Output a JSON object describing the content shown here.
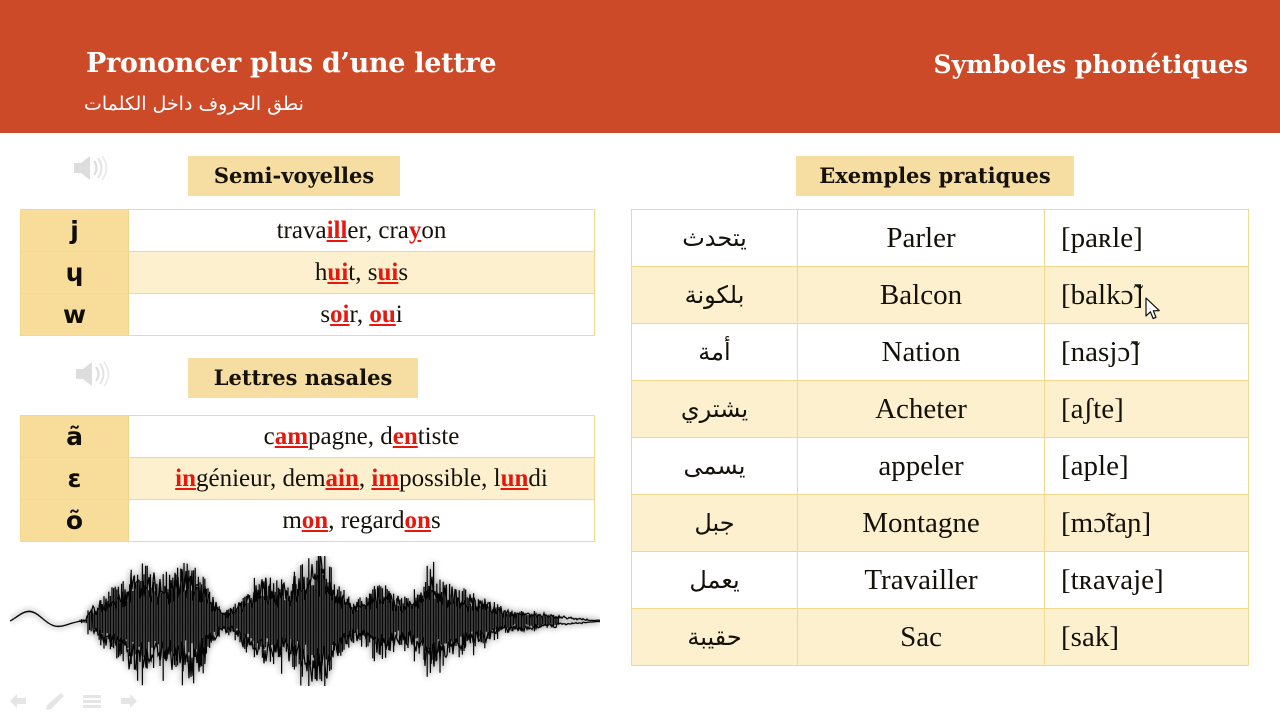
{
  "header": {
    "title": "Prononcer plus d’une lettre",
    "subtitle": "نطق الحروف داخل الكلمات",
    "right_title": "Symboles phonétiques",
    "background_color": "#cc4a28",
    "text_color": "#ffffff"
  },
  "colors": {
    "pill_bg": "#f6dda2",
    "symbol_cell_bg": "#f8dc99",
    "row_alt_bg": "#fdf0cf",
    "border": "#f2d98e",
    "highlight_red": "#e8170d"
  },
  "sections": {
    "semi_voyelles": {
      "pill_label": "Semi-voyelles",
      "rows": [
        {
          "symbol": "j",
          "example_html": "trava<span class=\"hl\">ill</span>er, cra<span class=\"hl\">y</span>on"
        },
        {
          "symbol": "ɥ",
          "example_html": "h<span class=\"hl\">ui</span>t, s<span class=\"hl\">ui</span>s"
        },
        {
          "symbol": "w",
          "example_html": "s<span class=\"hl\">oi</span>r, <span class=\"hl\">ou</span>i"
        }
      ]
    },
    "lettres_nasales": {
      "pill_label": "Lettres nasales",
      "rows": [
        {
          "symbol": "ã",
          "example_html": "c<span class=\"hl\">am</span>pagne, d<span class=\"hl\">en</span>tiste"
        },
        {
          "symbol": "ɛ",
          "example_html": "<span class=\"hl\">in</span>génieur, dem<span class=\"hl\">ain</span>, <span class=\"hl\">im</span>possible, l<span class=\"hl\">un</span>di"
        },
        {
          "symbol": "õ",
          "example_html": "m<span class=\"hl\">on</span>, regard<span class=\"hl\">on</span>s"
        }
      ]
    },
    "exemples_pratiques": {
      "pill_label": "Exemples pratiques",
      "rows": [
        {
          "arabic": "يتحدث",
          "french": "Parler",
          "phonetic": "[paʀle]"
        },
        {
          "arabic": "بلكونة",
          "french": "Balcon",
          "phonetic": "[balkɔ̃]"
        },
        {
          "arabic": "أمة",
          "french": "Nation",
          "phonetic": "[nasjɔ̃]"
        },
        {
          "arabic": "يشتري",
          "french": "Acheter",
          "phonetic": "[aʃte]"
        },
        {
          "arabic": "يسمى",
          "french": "appeler",
          "phonetic": "[aple]"
        },
        {
          "arabic": "جبل",
          "french": "Montagne",
          "phonetic": "[mɔ̃taɲ]"
        },
        {
          "arabic": "يعمل",
          "french": "Travailler",
          "phonetic": "[tʀavaje]"
        },
        {
          "arabic": "حقيبة",
          "french": "Sac",
          "phonetic": "[sak]"
        }
      ]
    }
  },
  "icons": {
    "speaker_1": "speaker-icon",
    "speaker_2": "speaker-icon",
    "waveform": "audio-waveform-graphic",
    "cursor": "mouse-pointer"
  },
  "toolbar": {
    "items": [
      {
        "name": "previous-slide-icon"
      },
      {
        "name": "pen-icon"
      },
      {
        "name": "menu-icon"
      },
      {
        "name": "next-slide-icon"
      }
    ]
  }
}
